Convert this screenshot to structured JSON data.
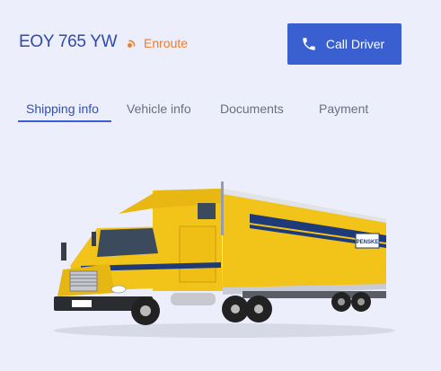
{
  "vehicle": {
    "plate": "EOY 765 YW",
    "status": "Enroute",
    "status_color": "#ef7d2d"
  },
  "actions": {
    "call_label": "Call Driver"
  },
  "tabs": [
    {
      "label": "Shipping info",
      "active": true
    },
    {
      "label": "Vehicle info",
      "active": false
    },
    {
      "label": "Documents",
      "active": false
    },
    {
      "label": "Payment",
      "active": false
    }
  ],
  "truck_image": {
    "brand_text": "PENSKE"
  },
  "colors": {
    "accent": "#3a5fd1",
    "background": "#eceefb",
    "truck_yellow": "#f2c318"
  }
}
